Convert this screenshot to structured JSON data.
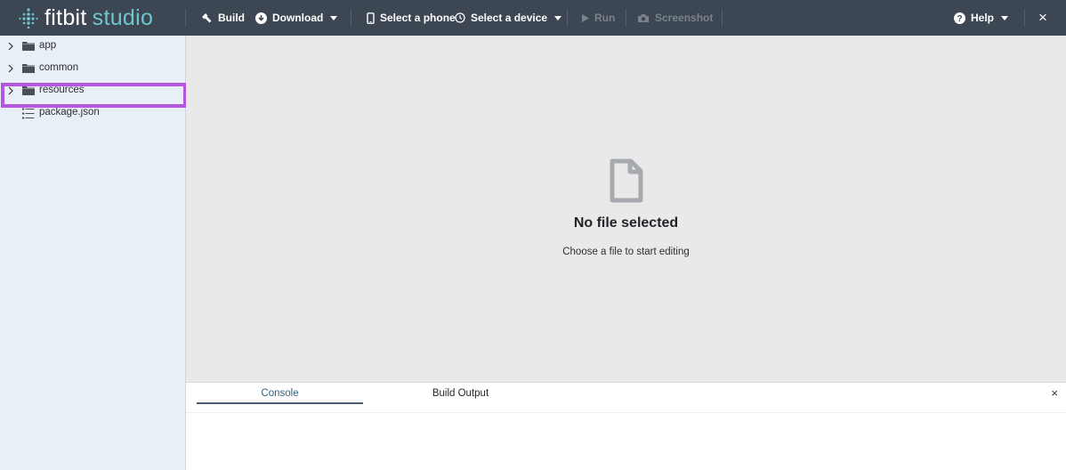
{
  "app": {
    "logo_word1": "fitbit",
    "logo_word2": "studio",
    "accent_color": "#6ec7cf"
  },
  "toolbar": {
    "build_label": "Build",
    "download_label": "Download",
    "phone_label": "Select a phone",
    "device_label": "Select a device",
    "run_label": "Run",
    "screenshot_label": "Screenshot",
    "help_label": "Help",
    "close_symbol": "×"
  },
  "sidebar": {
    "items": [
      {
        "label": "app",
        "type": "folder",
        "icon": "folder-icon",
        "expandable": true
      },
      {
        "label": "common",
        "type": "folder",
        "icon": "folder-icon",
        "expandable": true
      },
      {
        "label": "resources",
        "type": "folder",
        "icon": "folder-icon",
        "expandable": true,
        "highlighted": true
      },
      {
        "label": "package.json",
        "type": "file",
        "icon": "list-file-icon",
        "expandable": false
      }
    ],
    "highlight_color": "#b455e0"
  },
  "editor": {
    "empty_title": "No file selected",
    "empty_subtitle": "Choose a file to start editing",
    "empty_icon": "document-icon"
  },
  "bottom_panel": {
    "tabs": [
      {
        "label": "Console",
        "active": true
      },
      {
        "label": "Build Output",
        "active": false
      }
    ],
    "close_symbol": "×"
  }
}
